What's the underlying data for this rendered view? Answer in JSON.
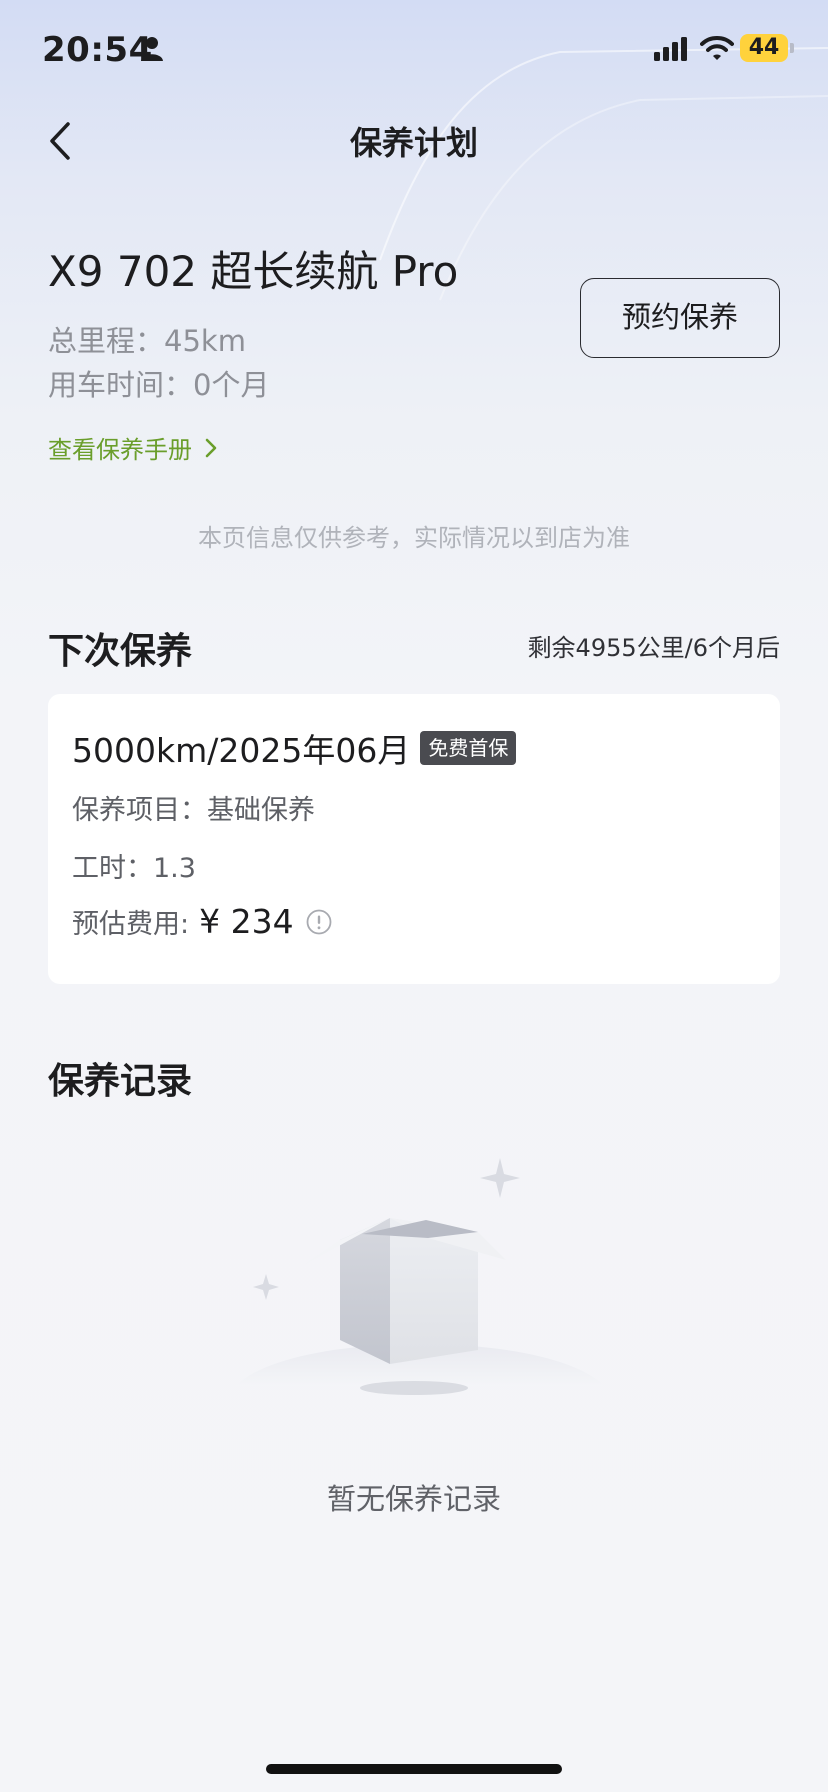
{
  "status_bar": {
    "time": "20:54",
    "battery": "44"
  },
  "nav": {
    "title": "保养计划"
  },
  "car": {
    "name": "X9 702 超长续航 Pro",
    "mileage_label": "总里程：",
    "mileage_value": "45km",
    "usage_label": "用车时间：",
    "usage_value": "0个月",
    "book_button": "预约保养",
    "manual_link": "查看保养手册"
  },
  "notice": "本页信息仅供参考，实际情况以到店为准",
  "next_maintenance": {
    "title": "下次保养",
    "remaining": "剩余4955公里/6个月后",
    "target": "5000km/2025年06月",
    "badge": "免费首保",
    "items_label": "保养项目：",
    "items_value": "基础保养",
    "hours_label": "工时：",
    "hours_value": "1.3",
    "cost_label": "预估费用:",
    "cost_value": "¥ 234"
  },
  "records": {
    "title": "保养记录",
    "empty_text": "暂无保养记录"
  },
  "colors": {
    "accent_link": "#6a9e2b",
    "battery": "#ffd23c",
    "badge_bg": "#4a4b50"
  },
  "icons": [
    "person-icon",
    "signal-icon",
    "wifi-icon",
    "back-arrow-icon",
    "chevron-right-icon",
    "info-icon",
    "empty-box-icon"
  ]
}
